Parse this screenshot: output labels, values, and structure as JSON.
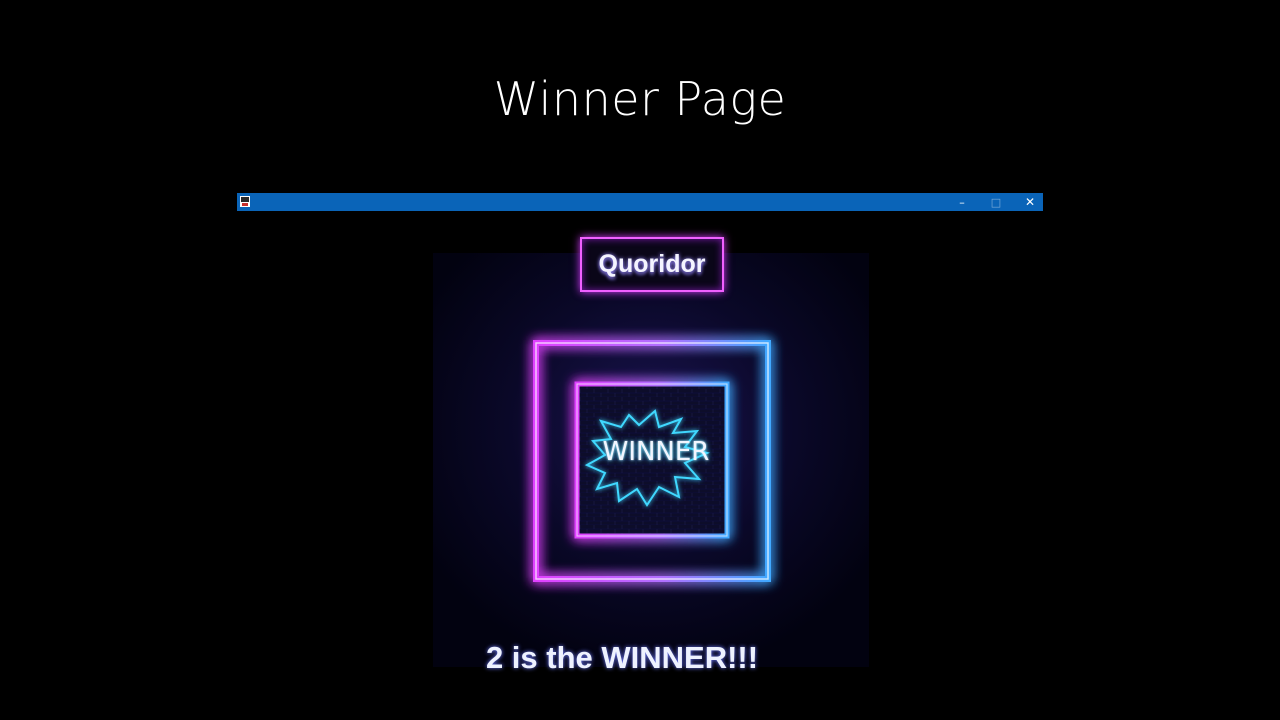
{
  "slide": {
    "title": "Winner Page"
  },
  "window": {
    "minimize_glyph": "–",
    "maximize_glyph": "□",
    "close_glyph": "✕",
    "titlebar_color": "#0a64b8",
    "icon": "java-app-icon"
  },
  "game": {
    "title": "Quoridor",
    "badge_text": "WINNER",
    "message": "2 is the WINNER!!!"
  },
  "colors": {
    "neon_pink": "#e040ff",
    "neon_blue": "#40a8ff",
    "badge_cyan": "#3fd8ff"
  }
}
